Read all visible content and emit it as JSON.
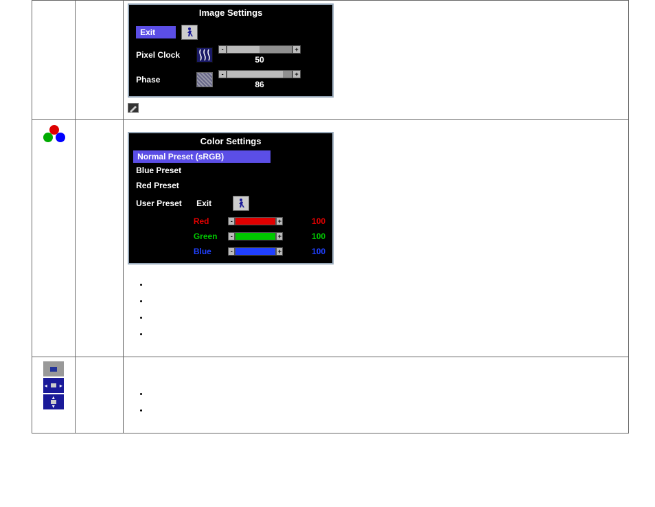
{
  "image_settings": {
    "title": "Image Settings",
    "exit_label": "Exit",
    "pixel_clock_label": "Pixel Clock",
    "pixel_clock_value": "50",
    "phase_label": "Phase",
    "phase_value": "86"
  },
  "color_settings": {
    "title": "Color Settings",
    "normal_preset": "Normal Preset (sRGB)",
    "blue_preset": "Blue Preset",
    "red_preset": "Red Preset",
    "user_preset": "User Preset",
    "exit_label": "Exit",
    "red_label": "Red",
    "red_value": "100",
    "green_label": "Green",
    "green_value": "100",
    "blue_label": "Blue",
    "blue_value": "100"
  },
  "colors": {
    "highlight": "#5b4ee6",
    "red": "#e00000",
    "green": "#00c800",
    "blue": "#2040ff"
  }
}
